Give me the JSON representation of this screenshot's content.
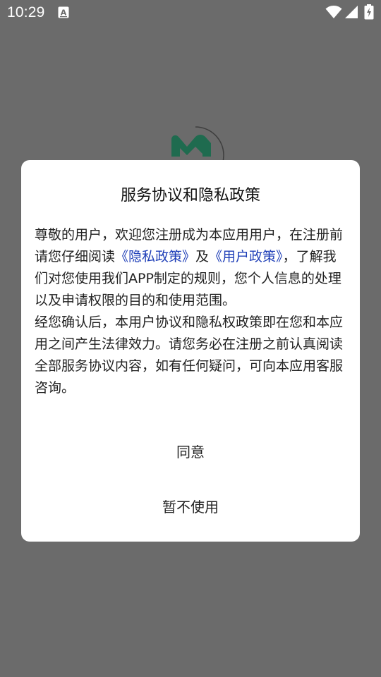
{
  "status_bar": {
    "time": "10:29",
    "notification_icon": "a-notification-icon",
    "wifi_icon": "wifi-icon",
    "signal_icon": "cell-signal-icon",
    "battery_icon": "battery-charging-icon"
  },
  "background": {
    "logo_icon": "app-logo-icon",
    "logo_color": "#1f6b4f"
  },
  "dialog": {
    "title": "服务协议和隐私政策",
    "paragraph1": {
      "text_before": "尊敬的用户，欢迎您注册成为本应用用户，在注册前请您仔细阅读",
      "privacy_link": "《隐私政策》",
      "conjunction": "及",
      "user_policy_link": "《用户政策》",
      "text_after": "，了解我们对您使用我们APP制定的规则，您个人信息的处理以及申请权限的目的和使用范围。"
    },
    "paragraph2": "经您确认后，本用户协议和隐私权政策即在您和本应用之间产生法律效力。请您务必在注册之前认真阅读全部服务协议内容，如有任何疑问，可向本应用客服咨询。",
    "agree_button": "同意",
    "decline_button": "暂不使用",
    "link_color": "#1f3fb8"
  }
}
